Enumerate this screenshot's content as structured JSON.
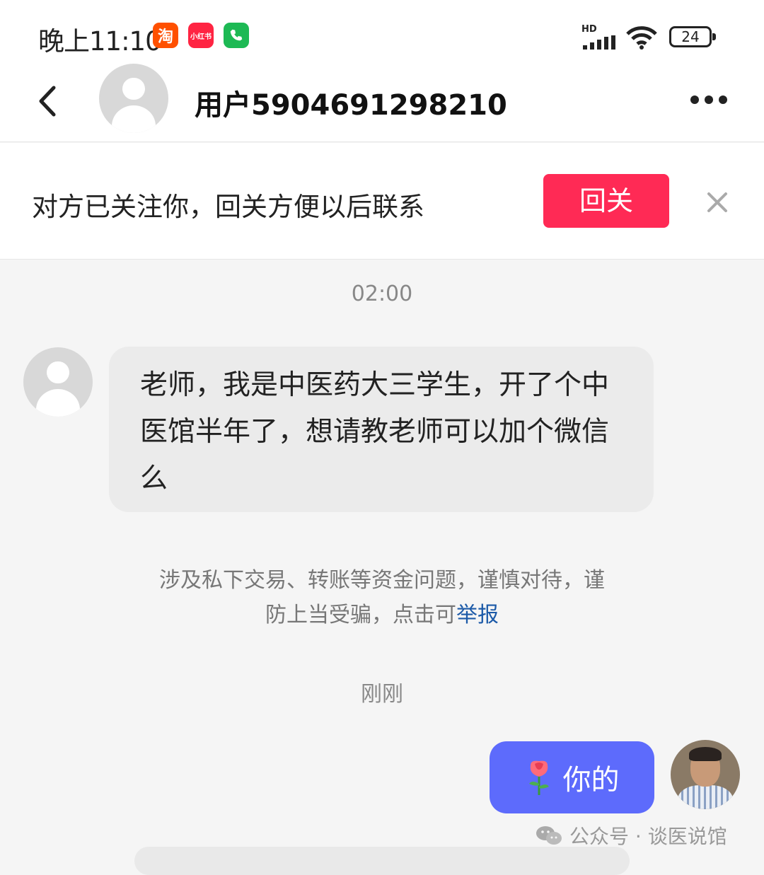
{
  "status": {
    "time": "晚上11:10",
    "taobao_label": "淘",
    "xhs_label": "小红书",
    "hd": "HD",
    "battery": "24"
  },
  "header": {
    "title": "用户5904691298210"
  },
  "follow_banner": {
    "text": "对方已关注你，回关方便以后联系",
    "button": "回关"
  },
  "chat": {
    "timestamp1": "02:00",
    "incoming_message": "老师，我是中医药大三学生，开了个中医馆半年了，想请教老师可以加个微信么",
    "warning_text": "涉及私下交易、转账等资金问题，谨慎对待，谨防上当受骗，点击可",
    "report_link": "举报",
    "timestamp2": "刚刚",
    "outgoing_message": "你的"
  },
  "watermark": "公众号 · 谈医说馆",
  "colors": {
    "follow_button": "#ff2a55",
    "outgoing_bubble": "#5d6bfc",
    "report_link": "#1c5aa8"
  }
}
